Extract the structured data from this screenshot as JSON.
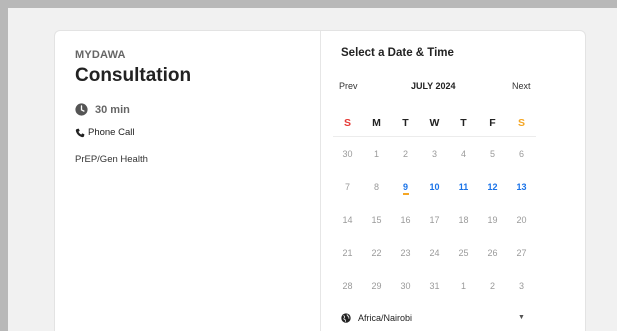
{
  "event": {
    "org": "MYDAWA",
    "title": "Consultation",
    "duration": "30 min",
    "call_type": "Phone Call",
    "service": "PrEP/Gen Health"
  },
  "scheduler": {
    "heading": "Select a Date & Time",
    "prev_label": "Prev",
    "next_label": "Next",
    "month_label": "JULY 2024",
    "weekdays": [
      "S",
      "M",
      "T",
      "W",
      "T",
      "F",
      "S"
    ],
    "weeks": [
      [
        "30",
        "1",
        "2",
        "3",
        "4",
        "5",
        "6"
      ],
      [
        "7",
        "8",
        "9",
        "10",
        "11",
        "12",
        "13"
      ],
      [
        "14",
        "15",
        "16",
        "17",
        "18",
        "19",
        "20"
      ],
      [
        "21",
        "22",
        "23",
        "24",
        "25",
        "26",
        "27"
      ],
      [
        "28",
        "29",
        "30",
        "31",
        "1",
        "2",
        "3"
      ]
    ],
    "timezone": "Africa/Nairobi"
  },
  "colors": {
    "accent": "#1a73e8",
    "sunday": "#e53935",
    "saturday": "#f5a623"
  },
  "icons": [
    "clock-icon",
    "phone-icon",
    "globe-icon",
    "chevron-down-icon"
  ]
}
